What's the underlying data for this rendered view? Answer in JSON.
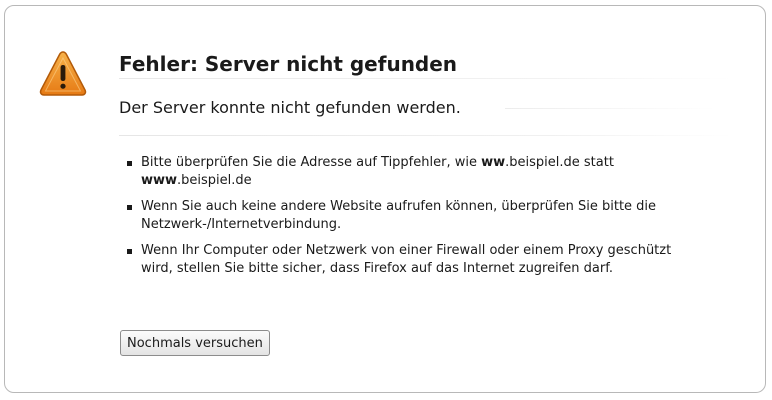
{
  "error_page": {
    "title": "Fehler: Server nicht gefunden",
    "subtitle": "Der Server konnte nicht gefunden werden.",
    "icon": "warning-triangle-icon",
    "accent_color": "#f0912a",
    "hints": [
      {
        "part1": "Bitte überprüfen Sie die Adresse auf Tippfehler, wie ",
        "bold1": "ww",
        "part2": ".beispiel.de statt ",
        "bold2": "www",
        "part3": ".beispiel.de"
      },
      {
        "text": "Wenn Sie auch keine andere Website aufrufen können, überprüfen Sie bitte die Netzwerk-/Internetverbindung."
      },
      {
        "text": "Wenn Ihr Computer oder Netzwerk von einer Firewall oder einem Proxy geschützt wird, stellen Sie bitte sicher, dass Firefox auf das Internet zugreifen darf."
      }
    ],
    "retry_label": "Nochmals versuchen"
  }
}
